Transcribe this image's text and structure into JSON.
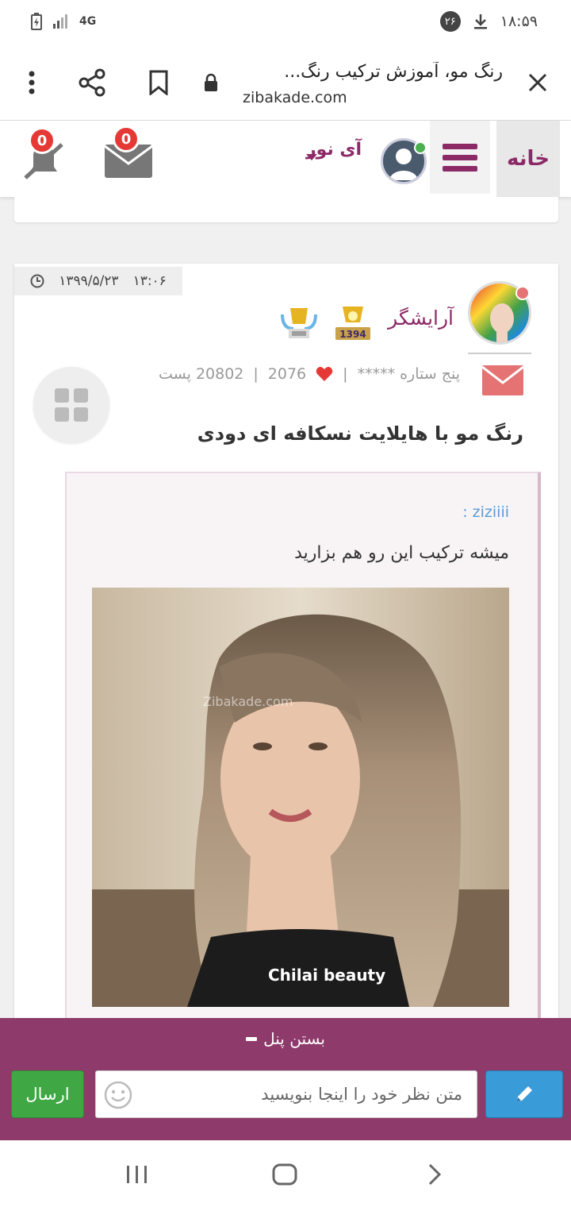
{
  "status_bar": {
    "network": "4G",
    "notification_count": "۲۶",
    "time": "۱۸:۵۹"
  },
  "browser": {
    "page_title": "رنگ مو، آموزش ترکیب رنگ...",
    "domain": "zibakade.com"
  },
  "site_header": {
    "home_label": "خانه",
    "username": "آی نور",
    "messages_count": "0",
    "notifications_count": "0"
  },
  "post": {
    "time": "۱۳:۰۶",
    "date": "۱۳۹۹/۵/۲۳",
    "author_name": "آرایشگر",
    "medal_year": "1394",
    "rank": "پنج ستاره *****",
    "likes": "2076",
    "posts": "20802 پست",
    "title": "رنگ مو با هایلایت نسکافه ای  دودی",
    "quote_author": "ziziiii :",
    "quote_text": "میشه ترکیب  این رو هم بزارید",
    "photo_watermark": "Zibakade.com",
    "photo_brand": "Chilai beauty"
  },
  "comment_panel": {
    "close_label": "بستن پنل",
    "input_placeholder": "متن نظر خود را اینجا بنویسید",
    "send_label": "ارسال"
  },
  "colors": {
    "brand": "#8c2a68",
    "panel": "#8e3a6a",
    "send": "#3fa845",
    "edit": "#3a9bd9"
  }
}
